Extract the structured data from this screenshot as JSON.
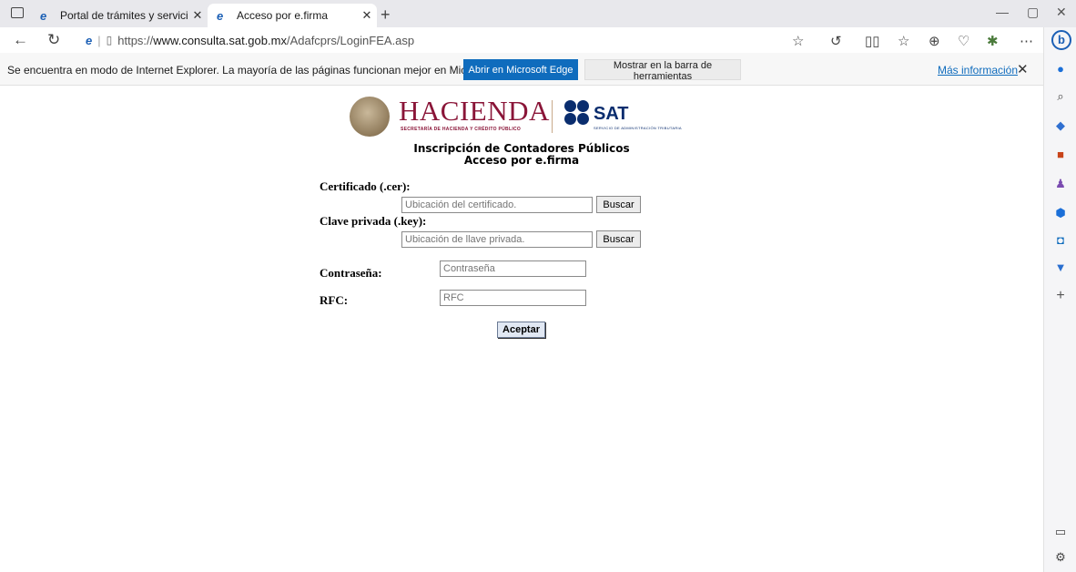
{
  "browser": {
    "tabs": [
      {
        "title": "Portal de trámites y servicios - S/",
        "close": "✕"
      },
      {
        "title": "Acceso por e.firma",
        "close": "✕"
      }
    ],
    "new_tab": "+",
    "url_prefix": "https://",
    "url_host": "www.consulta.sat.gob.mx",
    "url_path": "/Adafcprs/LoginFEA.asp"
  },
  "infobar": {
    "message": "Se encuentra en modo de Internet Explorer. La mayoría de las páginas funcionan mejor en Microsoft Edge.",
    "open_edge_label": "Abrir en Microsoft Edge",
    "show_toolbar_label": "Mostrar en la barra de herramientas",
    "more_info_label": "Más información",
    "close": "✕"
  },
  "header": {
    "hacienda": "HACIENDA",
    "hacienda_sub": "SECRETARÍA DE HACIENDA Y CRÉDITO PÚBLICO",
    "sat": "SAT",
    "sat_sub": "SERVICIO DE ADMINISTRACIÓN TRIBUTARIA",
    "title_line1": "Inscripción de Contadores Públicos",
    "title_line2": "Acceso por e.firma"
  },
  "form": {
    "cert_label": "Certificado (.cer):",
    "cert_placeholder": "Ubicación del certificado.",
    "key_label": "Clave privada (.key):",
    "key_placeholder": "Ubicación de llave privada.",
    "browse_label": "Buscar",
    "password_label": "Contraseña:",
    "password_placeholder": "Contraseña",
    "rfc_label": "RFC:",
    "rfc_placeholder": "RFC",
    "submit_label": "Aceptar"
  },
  "colors": {
    "hacienda": "#8a1538",
    "sat": "#0a2d6e",
    "edge_button": "#0f6cbd"
  }
}
